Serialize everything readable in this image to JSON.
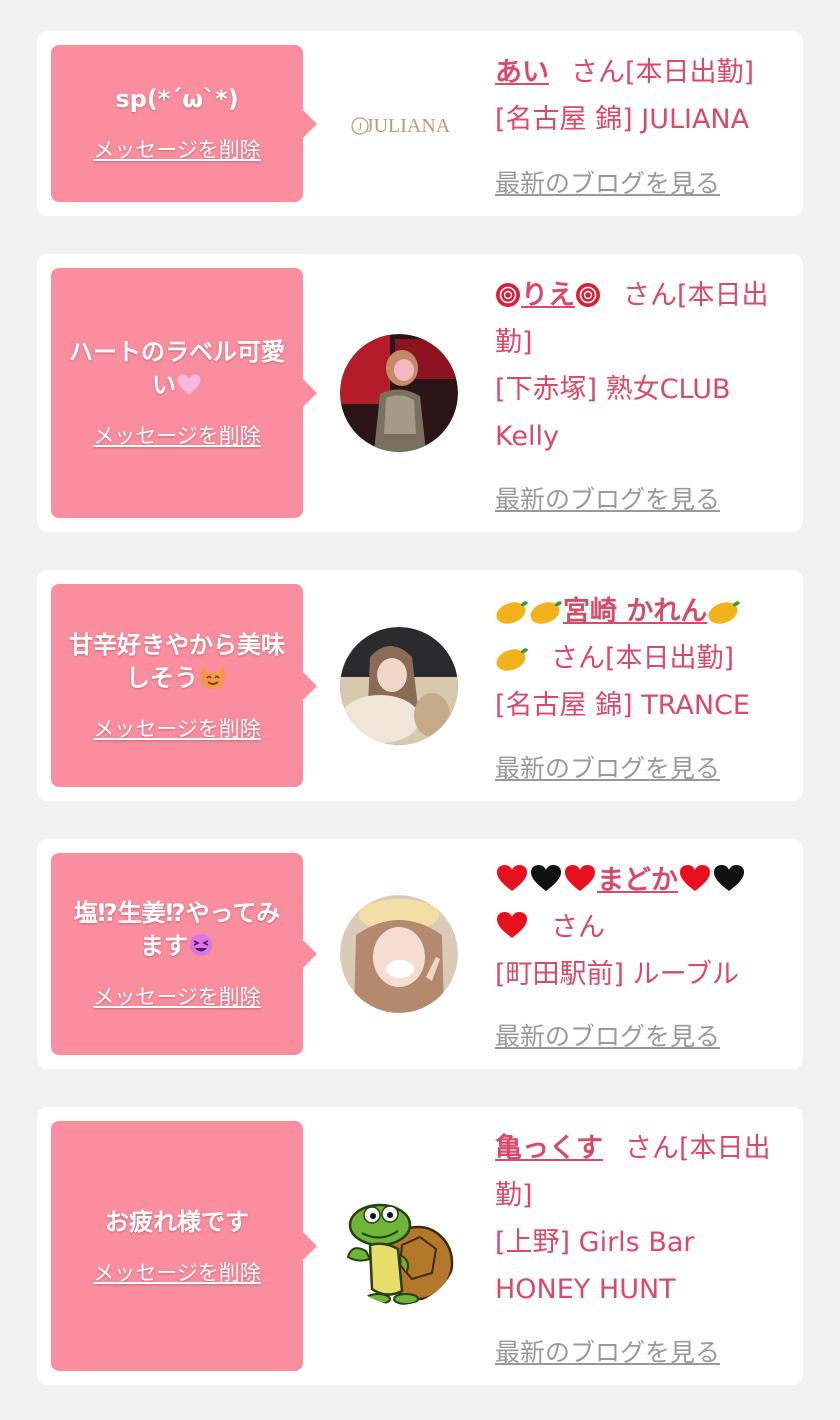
{
  "favorites": [
    {
      "message": "sp(*´ω`*)",
      "delete_label": "メッセージを削除",
      "name": "あい",
      "san_status": "さん[本日出勤]",
      "shop": "[名古屋 錦] JULIANA",
      "blog_label": "最新のブログを見る",
      "avatar_type": "logo",
      "logo_text": "JULIANA"
    },
    {
      "message": "ハートのラベル可愛い",
      "delete_label": "メッセージを削除",
      "name": "りえ",
      "san_status": "さん[本日出勤]",
      "shop": "[下赤塚] 熟女CLUB Kelly",
      "blog_label": "最新のブログを見る",
      "avatar_type": "photo"
    },
    {
      "message": "甘辛好きやから美味しそう",
      "delete_label": "メッセージを削除",
      "name": "宮崎 かれん",
      "san_status": "さん[本日出勤]",
      "shop": "[名古屋 錦] TRANCE",
      "blog_label": "最新のブログを見る",
      "avatar_type": "photo"
    },
    {
      "message": "塩⁉生姜⁉やってみます",
      "delete_label": "メッセージを削除",
      "name": "まどか",
      "san_status": "さん",
      "shop": "[町田駅前] ルーブル",
      "blog_label": "最新のブログを見る",
      "avatar_type": "photo"
    },
    {
      "message": "お疲れ様です",
      "delete_label": "メッセージを削除",
      "name": "亀っくす",
      "san_status": "さん[本日出勤]",
      "shop": "[上野] Girls Bar HONEY HUNT",
      "blog_label": "最新のブログを見る",
      "avatar_type": "illustration"
    }
  ],
  "colors": {
    "page_bg": "#f2f2f2",
    "card_bg": "#ffffff",
    "message_bg": "#fa8d9e",
    "accent_text": "#d64a6a",
    "blog_link": "#999999"
  },
  "icons": [
    "rose-icon",
    "mango-icon",
    "red-heart-icon",
    "black-heart-icon",
    "pink-heart-icon",
    "cat-smile-icon",
    "star-struck-icon",
    "turtle-illustration"
  ]
}
